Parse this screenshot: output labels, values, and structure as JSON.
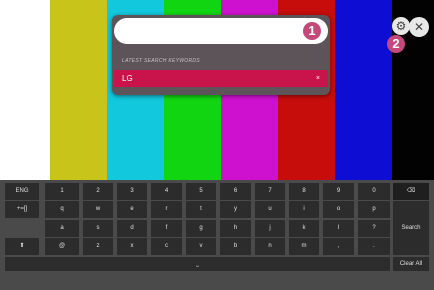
{
  "colors": {
    "bars": [
      "#ffffff",
      "#c9c41a",
      "#12c8dd",
      "#12d512",
      "#ce11cf",
      "#c70c0c",
      "#0d0dd4",
      "#020202"
    ],
    "accent": "#c8144a",
    "badge": "#c4497a"
  },
  "search": {
    "placeholder": "",
    "badge_primary": "1",
    "latest_heading": "LATEST SEARCH KEYWORDS",
    "keyword": "LG",
    "keyword_delete": "×"
  },
  "top_controls": {
    "settings_icon": "gear-icon",
    "badge_secondary": "2",
    "close_icon": "close-icon",
    "close_glyph": "✕",
    "gear_glyph": "⚙"
  },
  "keyboard": {
    "row1": [
      "ENG",
      "1",
      "2",
      "3",
      "4",
      "5",
      "6",
      "7",
      "8",
      "9",
      "0"
    ],
    "backspace_glyph": "⌫",
    "row2": [
      "+=[]",
      "q",
      "w",
      "e",
      "r",
      "t",
      "y",
      "u",
      "i",
      "o",
      "p"
    ],
    "row3": [
      "a",
      "s",
      "d",
      "f",
      "g",
      "h",
      "j",
      "k",
      "l",
      "?"
    ],
    "row4": [
      "@",
      "z",
      "x",
      "c",
      "v",
      "b",
      "n",
      "m",
      ",",
      "."
    ],
    "shift_glyph": "⬆",
    "space_glyph": "⎵",
    "search_label": "Search",
    "clear_label": "Clear All"
  }
}
